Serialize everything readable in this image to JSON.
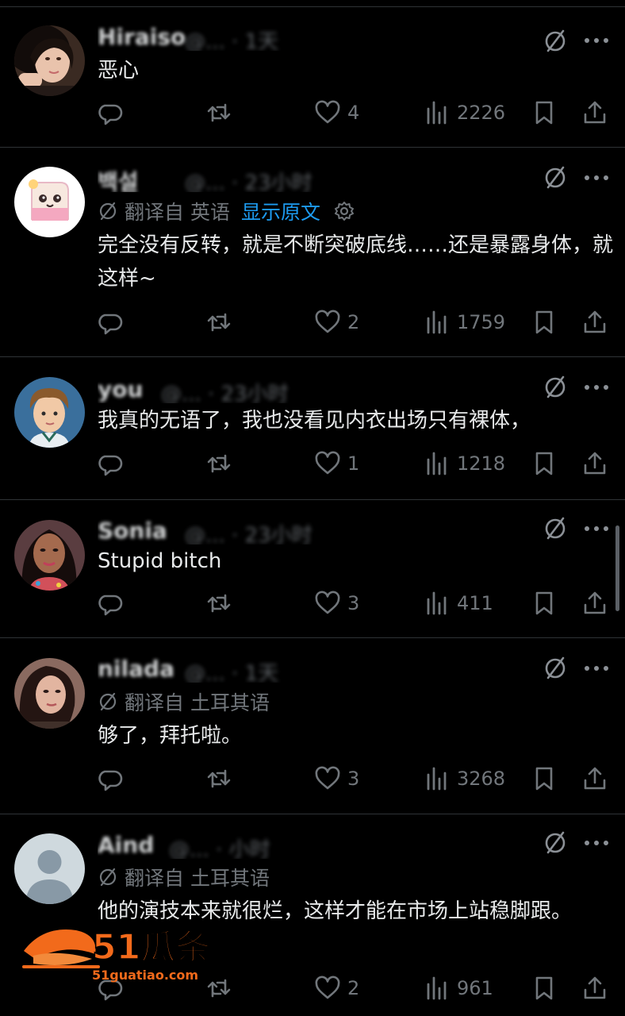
{
  "posts": [
    {
      "name": "Hiraiso",
      "handle": "@... · 1天",
      "avatar": "photo-woman",
      "translated": false,
      "text": "恶心",
      "replies": "",
      "reposts": "",
      "likes": "4",
      "views": "2226"
    },
    {
      "name": "백설",
      "handle": "@... · 23小时",
      "avatar": "cartoon-toast",
      "translated": true,
      "translate_label": "翻译自 英语",
      "show_original": "显示原文",
      "text": "完全没有反转，就是不断突破底线……还是暴露身体，就这样~",
      "replies": "",
      "reposts": "",
      "likes": "2",
      "views": "1759"
    },
    {
      "name": "you",
      "handle": "@... · 23小时",
      "avatar": "cartoon-boy",
      "translated": false,
      "text": "我真的无语了，我也没看见内衣出场只有裸体，",
      "replies": "",
      "reposts": "",
      "likes": "1",
      "views": "1218"
    },
    {
      "name": "Sonia",
      "handle": "@... · 23小时",
      "avatar": "photo-woman-2",
      "translated": false,
      "text": "Stupid bitch",
      "replies": "",
      "reposts": "",
      "likes": "3",
      "views": "411"
    },
    {
      "name": "nilada",
      "handle": "@... · 1天",
      "avatar": "photo-woman-3",
      "translated": true,
      "translate_label": "翻译自 土耳其语",
      "text": "够了，拜托啦。",
      "replies": "",
      "reposts": "",
      "likes": "3",
      "views": "3268"
    },
    {
      "name": "Aind",
      "handle": "@... · 小时",
      "avatar": "default",
      "translated": true,
      "translate_label": "翻译自 土耳其语",
      "text": "他的演技本来就很烂，这样才能在市场上站稳脚跟。",
      "replies": "",
      "reposts": "",
      "likes": "2",
      "views": "961"
    }
  ],
  "watermark": {
    "brand": "51瓜条",
    "url": "51guatiao.com"
  },
  "colors": {
    "background": "#000000",
    "text": "#e7e9ea",
    "muted": "#71767b",
    "link": "#1d9bf0",
    "divider": "#2f3336",
    "watermark": "#f26a1b"
  }
}
